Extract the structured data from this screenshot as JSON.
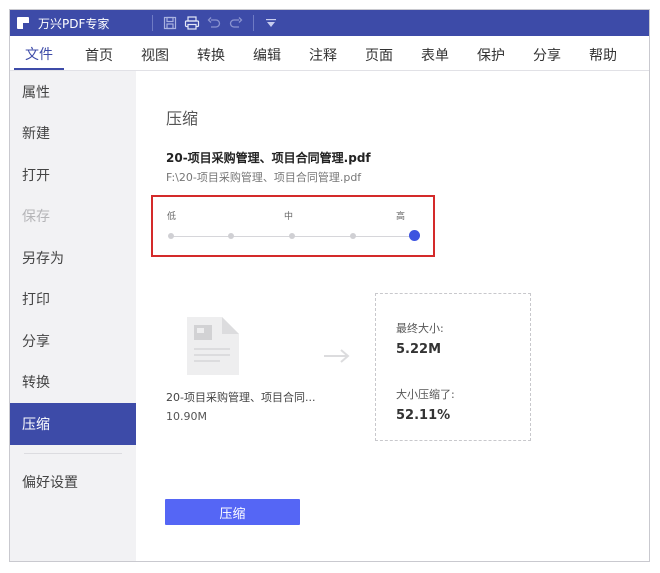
{
  "window": {
    "title": "万兴PDF专家"
  },
  "menu": [
    {
      "label": "文件",
      "active": true
    },
    {
      "label": "首页"
    },
    {
      "label": "视图"
    },
    {
      "label": "转换"
    },
    {
      "label": "编辑"
    },
    {
      "label": "注释"
    },
    {
      "label": "页面"
    },
    {
      "label": "表单"
    },
    {
      "label": "保护"
    },
    {
      "label": "分享"
    },
    {
      "label": "帮助"
    }
  ],
  "sidebar": {
    "items": [
      {
        "label": "属性"
      },
      {
        "label": "新建"
      },
      {
        "label": "打开"
      },
      {
        "label": "保存",
        "disabled": true
      },
      {
        "label": "另存为"
      },
      {
        "label": "打印"
      },
      {
        "label": "分享"
      },
      {
        "label": "转换"
      },
      {
        "label": "压缩",
        "active": true
      }
    ],
    "preferences": "偏好设置"
  },
  "compress": {
    "title": "压缩",
    "file_name": "20-项目采购管理、项目合同管理.pdf",
    "file_path": "F:\\20-项目采购管理、项目合同管理.pdf",
    "levels": {
      "low": "低",
      "mid": "中",
      "high": "高"
    },
    "slider_value": 1.0,
    "original_name": "20-项目采购管理、项目合同...",
    "original_size": "10.90M",
    "final_size_label": "最终大小:",
    "final_size": "5.22M",
    "ratio_label": "大小压缩了:",
    "ratio": "52.11%",
    "button_label": "压缩"
  },
  "colors": {
    "accent": "#3d4ba8",
    "button": "#5566f5",
    "slider_thumb": "#3d53e0",
    "highlight_border": "#d42a2a"
  }
}
